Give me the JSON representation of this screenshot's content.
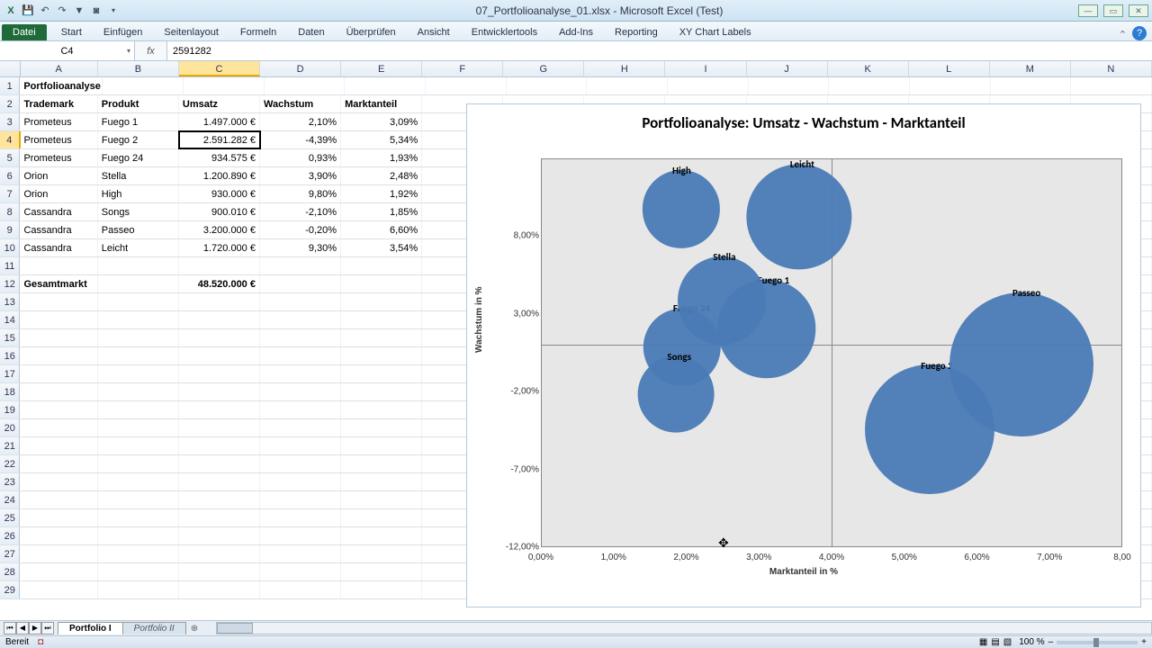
{
  "app": {
    "title": "07_Portfolioanalyse_01.xlsx - Microsoft Excel (Test)"
  },
  "ribbon": {
    "file": "Datei",
    "tabs": [
      "Start",
      "Einfügen",
      "Seitenlayout",
      "Formeln",
      "Daten",
      "Überprüfen",
      "Ansicht",
      "Entwicklertools",
      "Add-Ins",
      "Reporting",
      "XY Chart Labels"
    ]
  },
  "formula": {
    "namebox": "C4",
    "fx": "fx",
    "value": "2591282"
  },
  "columns": [
    "A",
    "B",
    "C",
    "D",
    "E",
    "F",
    "G",
    "H",
    "I",
    "J",
    "K",
    "L",
    "M",
    "N"
  ],
  "table": {
    "title": "Portfolioanalyse",
    "headers": [
      "Trademark",
      "Produkt",
      "Umsatz",
      "Wachstum",
      "Marktanteil"
    ],
    "rows": [
      [
        "Prometeus",
        "Fuego 1",
        "1.497.000 €",
        "2,10%",
        "3,09%"
      ],
      [
        "Prometeus",
        "Fuego 2",
        "2.591.282 €",
        "-4,39%",
        "5,34%"
      ],
      [
        "Prometeus",
        "Fuego 24",
        "934.575 €",
        "0,93%",
        "1,93%"
      ],
      [
        "Orion",
        "Stella",
        "1.200.890 €",
        "3,90%",
        "2,48%"
      ],
      [
        "Orion",
        "High",
        "930.000 €",
        "9,80%",
        "1,92%"
      ],
      [
        "Cassandra",
        "Songs",
        "900.010 €",
        "-2,10%",
        "1,85%"
      ],
      [
        "Cassandra",
        "Passeo",
        "3.200.000 €",
        "-0,20%",
        "6,60%"
      ],
      [
        "Cassandra",
        "Leicht",
        "1.720.000 €",
        "9,30%",
        "3,54%"
      ]
    ],
    "total_label": "Gesamtmarkt",
    "total_value": "48.520.000 €"
  },
  "chart_data": {
    "type": "scatter",
    "title": "Portfolioanalyse: Umsatz - Wachstum - Marktanteil",
    "xlabel": "Marktanteil in %",
    "ylabel": "Wachstum in %",
    "xlim": [
      0,
      8
    ],
    "ylim": [
      -12,
      13
    ],
    "xticks": [
      "0,00%",
      "1,00%",
      "2,00%",
      "3,00%",
      "4,00%",
      "5,00%",
      "6,00%",
      "7,00%",
      "8,00"
    ],
    "yticks": [
      "-12,00%",
      "-7,00%",
      "-2,00%",
      "3,00%",
      "8,00%"
    ],
    "series": [
      {
        "name": "Fuego 1",
        "x": 3.09,
        "y": 2.1,
        "size": 1497000
      },
      {
        "name": "Fuego 2",
        "x": 5.34,
        "y": -4.39,
        "size": 2591282
      },
      {
        "name": "Fuego 24",
        "x": 1.93,
        "y": 0.93,
        "size": 934575
      },
      {
        "name": "Stella",
        "x": 2.48,
        "y": 3.9,
        "size": 1200890
      },
      {
        "name": "High",
        "x": 1.92,
        "y": 9.8,
        "size": 930000
      },
      {
        "name": "Songs",
        "x": 1.85,
        "y": -2.1,
        "size": 900010
      },
      {
        "name": "Passeo",
        "x": 6.6,
        "y": -0.2,
        "size": 3200000
      },
      {
        "name": "Leicht",
        "x": 3.54,
        "y": 9.3,
        "size": 1720000
      }
    ]
  },
  "sheets": {
    "active": "Portfolio I",
    "inactive": "Portfolio II"
  },
  "status": {
    "ready": "Bereit",
    "zoom": "100 %",
    "plus": "+",
    "minus": "–"
  }
}
